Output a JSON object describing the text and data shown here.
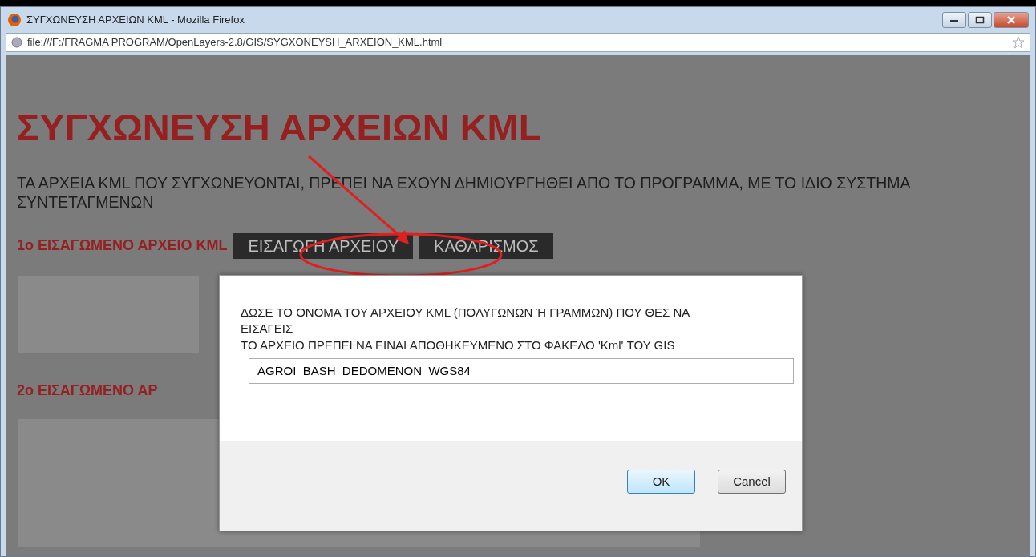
{
  "window": {
    "title": "ΣΥΓΧΩΝΕΥΣΗ ΑΡΧΕΙΩΝ KML - Mozilla Firefox"
  },
  "address_bar": {
    "url": "file:///F:/FRAGMA PROGRAM/OpenLayers-2.8/GIS/SYGXONEYSH_ARXEION_KML.html"
  },
  "page": {
    "heading": "ΣΥΓΧΩΝΕΥΣΗ ΑΡΧΕΙΩΝ KML",
    "note": "ΤΑ ΑΡΧΕΙΑ KML ΠΟΥ ΣΥΓΧΩΝΕΥΟΝΤΑΙ, ΠΡΕΠΕΙ ΝΑ ΕΧΟΥΝ ΔΗΜΙΟΥΡΓΗΘΕΙ ΑΠΟ ΤΟ ΠΡΟΓΡΑΜΜΑ, ΜΕ ΤΟ ΙΔΙΟ ΣΥΣΤΗΜΑ ΣΥΝΤΕΤΑΓΜΕΝΩΝ",
    "sections": [
      {
        "label": "1ο ΕΙΣΑΓΩΜΕΝΟ ΑΡΧΕΙΟ KML",
        "buttons": [
          "ΕΙΣΑΓΩΓΗ ΑΡΧΕΙΟΥ",
          "ΚΑΘΑΡΙΣΜΟΣ"
        ]
      },
      {
        "label": "2ο ΕΙΣΑΓΩΜΕΝΟ ΑΡ"
      }
    ]
  },
  "dialog": {
    "message": [
      "ΔΩΣΕ ΤΟ ΟΝΟΜΑ ΤΟΥ ΑΡΧΕΙΟΥ KML (ΠΟΛΥΓΩΝΩΝ Ή ΓΡΑΜΜΩΝ) ΠΟΥ ΘΕΣ ΝΑ ΕΙΣΑΓΕΙΣ",
      "ΤΟ ΑΡΧΕΙΟ ΠΡΕΠΕΙ ΝΑ ΕΙΝΑΙ ΑΠΟΘΗΚΕΥΜΕΝΟ ΣΤΟ ΦΑΚΕΛΟ 'Kml' ΤΟΥ GIS"
    ],
    "value": "AGROI_BASH_DEDOMENON_WGS84",
    "buttons": [
      {
        "label": "OK",
        "focused": true
      },
      {
        "label": "Cancel",
        "focused": false
      }
    ]
  }
}
